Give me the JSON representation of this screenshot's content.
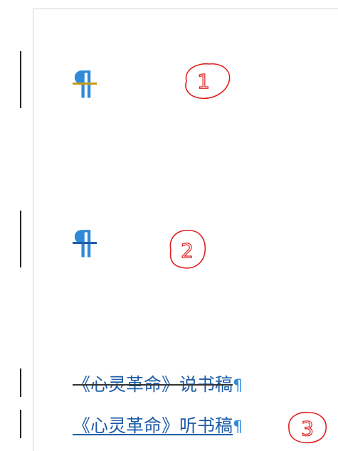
{
  "document": {
    "paragraph_mark": "¶",
    "lines": [
      {
        "text": "《心灵革命》说书稿",
        "mark": "¶",
        "revision": "deleted"
      },
      {
        "text": "《心灵革命》听书稿",
        "mark": "¶",
        "revision": "inserted"
      }
    ]
  },
  "annotations": {
    "labels": [
      "1",
      "2",
      "3"
    ],
    "color": "#e02020"
  },
  "colors": {
    "pilcrow": "#2f8ad8",
    "marker_1": "#c79a16",
    "marker_2": "#1f5da8",
    "text": "#1f5da8"
  }
}
